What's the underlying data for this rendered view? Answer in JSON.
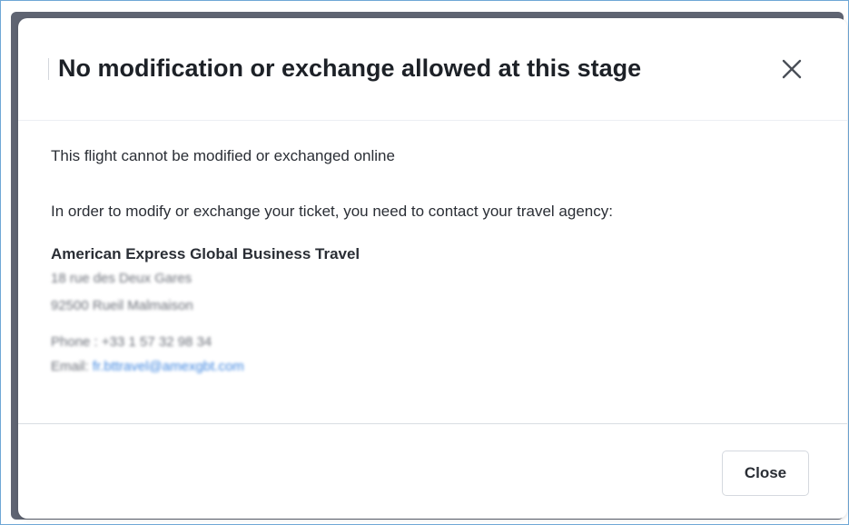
{
  "dialog": {
    "title": "No modification or exchange allowed at this stage",
    "close_icon": "close-icon",
    "body": {
      "line1": "This flight cannot be modified or exchanged online",
      "line2": "In order to modify or exchange your ticket, you need to contact your travel agency:",
      "agency": {
        "name": "American Express Global Business Travel",
        "address_line1": "18 rue des Deux Gares",
        "address_line2": "92500 Rueil Malmaison",
        "phone_label": "Phone : ",
        "phone": "+33 1 57 32 98 34",
        "email_label": "Email: ",
        "email": "fr.bttravel@amexgbt.com"
      }
    },
    "footer": {
      "close_label": "Close"
    }
  },
  "colors": {
    "backdrop": "#5f6472",
    "link": "#3f86e0",
    "text": "#2a2e35",
    "frame_border": "#6fa7d6"
  }
}
